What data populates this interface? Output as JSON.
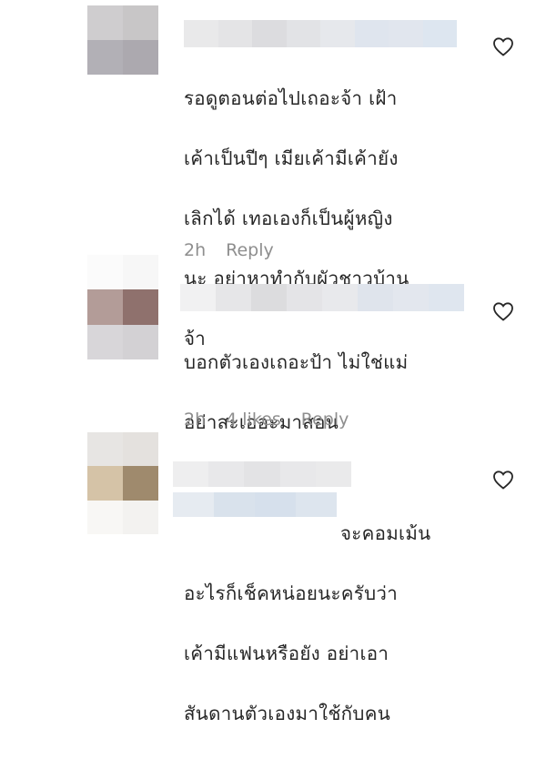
{
  "comments": [
    {
      "text_lines": [
        "รอดูตอนต่อไปเถอะจ้า เฝ้า",
        "เค้าเป็นปีๆ เมียเค้ามีเค้ายัง",
        "เลิกได้ เทอเองก็เป็นผู้หญิง",
        "นะ อย่าหาทำกับผัวชาวบ้าน",
        "จ้า"
      ],
      "time": "2h",
      "likes": "",
      "reply_label": "Reply",
      "like_icon": "heart-outline-icon",
      "avatar_colors": [
        "#cfcdcf",
        "#c8c6c7",
        "#b2b0b6",
        "#aca9af"
      ],
      "name_blur_colors": [
        "#e9e9ea",
        "#e4e4e6",
        "#dcdcdf",
        "#e2e3e6",
        "#e6e8ec",
        "#dfe5ee",
        "#e1e6ee",
        "#dde6f0"
      ]
    },
    {
      "text_lines": [
        "บอกตัวเองเถอะป้า ไม่ใช่แม่",
        "อย่าสะเออะมาสอน"
      ],
      "time": "2h",
      "likes": "4 likes",
      "reply_label": "Reply",
      "like_icon": "heart-outline-icon",
      "avatar_colors": [
        "#fbfbfb",
        "#f7f7f7",
        "#b39c98",
        "#8f716d",
        "#d8d6d9",
        "#d3d1d4"
      ],
      "name_blur_colors": [
        "#f1f1f2",
        "#e6e6e8",
        "#dcdcde",
        "#e4e4e7",
        "#e8e9ec",
        "#dfe4ec",
        "#e3e7ee",
        "#dfe6ef"
      ]
    },
    {
      "text_lines": [
        "จะคอมเม้น",
        "อะไรก็เช็คหน่อยนะครับว่า",
        "เค้ามีแฟนหรือยัง อย่าเอา",
        "สันดานตัวเองมาใช้กับคน"
      ],
      "time": "",
      "likes": "",
      "reply_label": "",
      "like_icon": "heart-outline-icon",
      "avatar_colors": [
        "#e7e5e3",
        "#e4e1de",
        "#d5c3a7",
        "#9f8a6d",
        "#f8f7f5",
        "#f3f2f0"
      ],
      "name_blur_colors": [
        "#eeeeef",
        "#e8e8ea",
        "#e3e3e5",
        "#e8e8ea",
        "#eaeaeb"
      ],
      "name_blur2_colors": [
        "#e6ebf1",
        "#d9e2ec",
        "#d6e0ec",
        "#dde5ee"
      ]
    }
  ]
}
